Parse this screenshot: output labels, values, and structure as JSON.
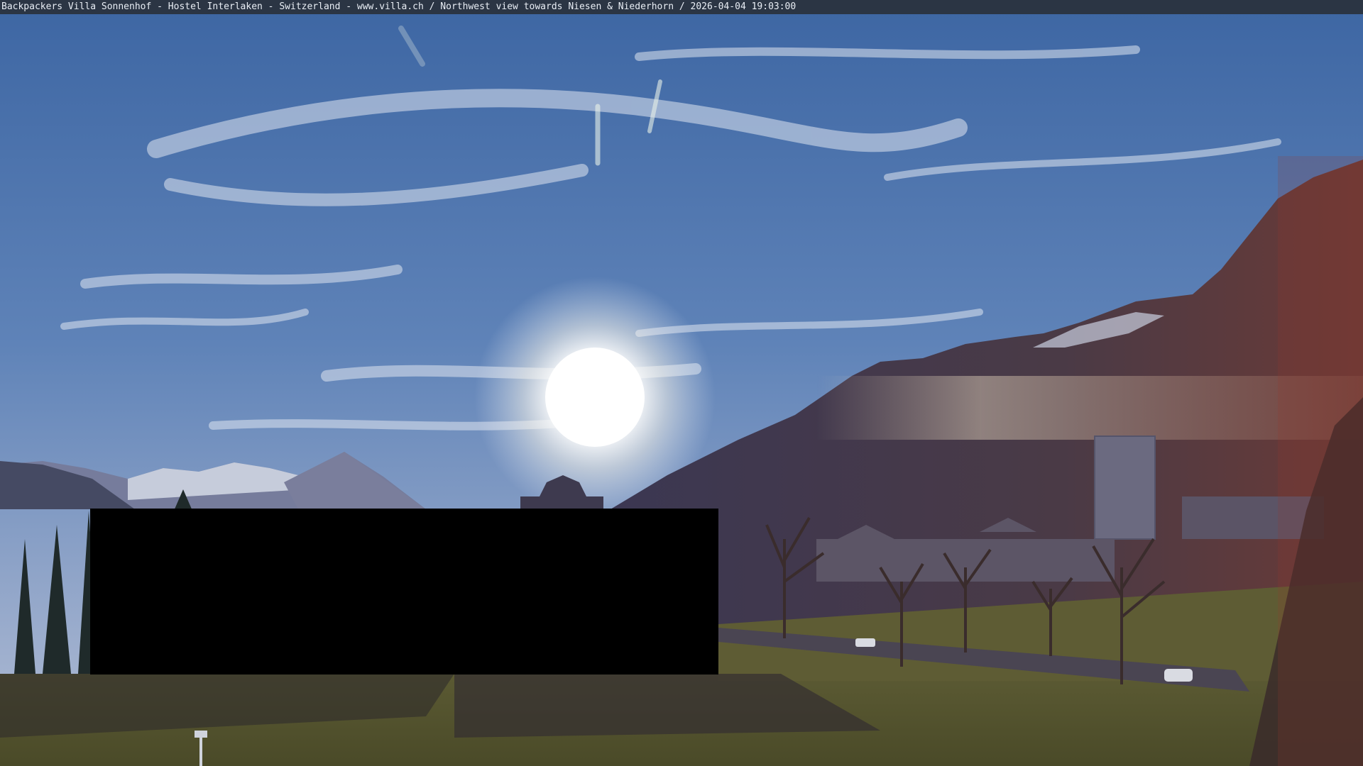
{
  "caption": {
    "text": "Backpackers Villa Sonnenhof - Hostel Interlaken - Switzerland - www.villa.ch / Northwest view towards Niesen & Niederhorn / 2026-04-04 19:03:00"
  },
  "colors": {
    "sky_top": "#3f6aa6",
    "sky_mid": "#6d8fbf",
    "sky_horizon": "#a9b8d3",
    "sun": "#ffffff",
    "mountain_dark": "#3a3550",
    "mountain_far": "#6a6f90",
    "snow": "#d8dde8",
    "grass": "#5a5a2e",
    "grass_shadow": "#2e2a2a",
    "caption_bg": "#2b3544",
    "redaction": "#000000"
  }
}
